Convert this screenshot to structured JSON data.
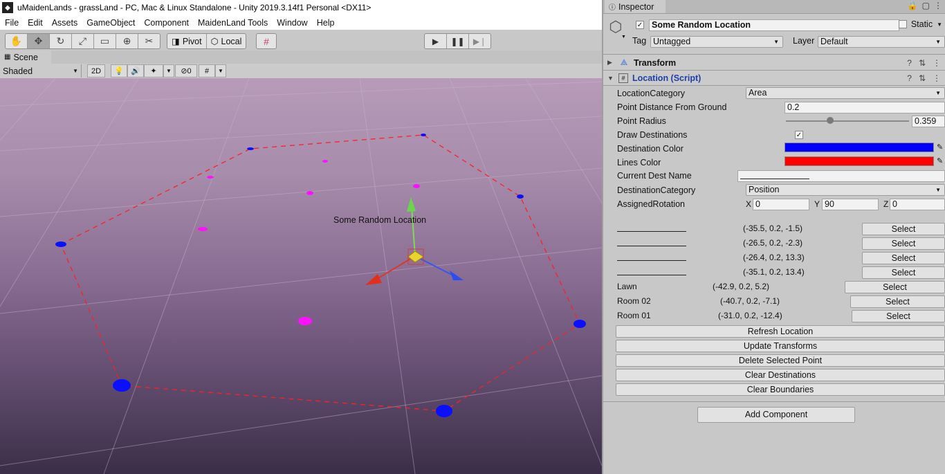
{
  "window": {
    "title": "uMaidenLands - grassLand - PC, Mac & Linux Standalone - Unity 2019.3.14f1 Personal <DX11>"
  },
  "menu": [
    "File",
    "Edit",
    "Assets",
    "GameObject",
    "Component",
    "MaidenLand Tools",
    "Window",
    "Help"
  ],
  "toolbar": {
    "pivot": "Pivot",
    "local": "Local"
  },
  "scene": {
    "tab_label": "Scene",
    "shading_mode": "Shaded",
    "mode_2d": "2D",
    "hidden_count": "0",
    "object_label": "Some Random Location"
  },
  "inspector": {
    "tab_label": "Inspector",
    "object_name": "Some Random Location",
    "static_label": "Static",
    "tag_label": "Tag",
    "tag_value": "Untagged",
    "layer_label": "Layer",
    "layer_value": "Default",
    "transform_title": "Transform",
    "script_title": "Location (Script)",
    "fields": {
      "location_category_label": "LocationCategory",
      "location_category_value": "Area",
      "point_distance_label": "Point Distance From Ground",
      "point_distance_value": "0.2",
      "point_radius_label": "Point Radius",
      "point_radius_value": "0.359",
      "point_radius_slider": 0.359,
      "draw_destinations_label": "Draw Destinations",
      "destination_color_label": "Destination Color",
      "destination_color": "#0000ff",
      "lines_color_label": "Lines Color",
      "lines_color": "#ff0000",
      "current_dest_label": "Current Dest Name",
      "destination_category_label": "DestinationCategory",
      "destination_category_value": "Position",
      "assigned_rotation_label": "AssignedRotation",
      "rot_x_label": "X",
      "rot_x": "0",
      "rot_y_label": "Y",
      "rot_y": "90",
      "rot_z_label": "Z",
      "rot_z": "0"
    },
    "points": [
      {
        "name": "",
        "coords": "(-35.5, 0.2, -1.5)",
        "button": "Select"
      },
      {
        "name": "",
        "coords": "(-26.5, 0.2, -2.3)",
        "button": "Select"
      },
      {
        "name": "",
        "coords": "(-26.4, 0.2, 13.3)",
        "button": "Select"
      },
      {
        "name": "",
        "coords": "(-35.1, 0.2, 13.4)",
        "button": "Select"
      },
      {
        "name": "Lawn",
        "coords": "(-42.9, 0.2, 5.2)",
        "button": "Select"
      },
      {
        "name": "Room 02",
        "coords": "(-40.7, 0.2, -7.1)",
        "button": "Select"
      },
      {
        "name": "Room 01",
        "coords": "(-31.0, 0.2, -12.4)",
        "button": "Select"
      }
    ],
    "actions": [
      "Refresh Location",
      "Update Transforms",
      "Delete Selected Point",
      "Clear Destinations",
      "Clear Boundaries"
    ],
    "add_component": "Add Component"
  }
}
